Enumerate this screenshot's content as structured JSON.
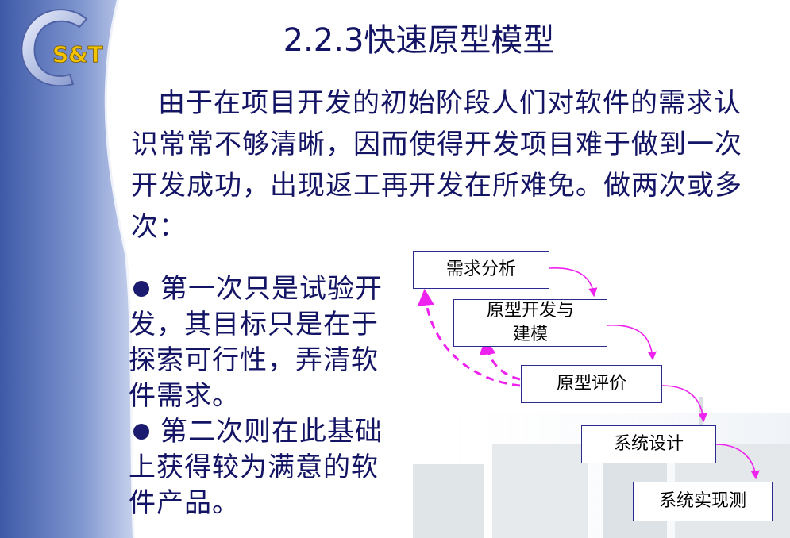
{
  "title": "2.2.3快速原型模型",
  "logo": {
    "text": "S&T",
    "letter": "C"
  },
  "intro": "由于在项目开发的初始阶段人们对软件的需求认识常常不够清晰，因而使得开发项目难于做到一次开发成功，出现返工再开发在所难免。做两次或多次：",
  "bullets": [
    "第一次只是试验开发，其目标只是在于探索可行性，弄清软件需求。",
    "第二次则在此基础上获得较为满意的软件产品。"
  ],
  "diagram": {
    "steps": [
      {
        "label": "需求分析"
      },
      {
        "label": "原型开发与\n建模"
      },
      {
        "label": "原型评价"
      },
      {
        "label": "系统设计"
      },
      {
        "label": "系统实现测"
      }
    ],
    "colors": {
      "arrow": "#ee22ee",
      "box_border": "#2b2b8f"
    }
  },
  "colors": {
    "text": "#141464",
    "panel": "#5a73b8"
  }
}
